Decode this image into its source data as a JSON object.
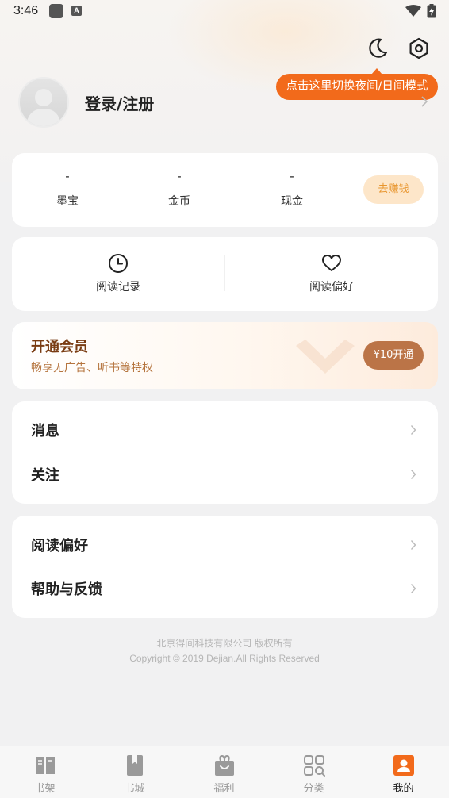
{
  "status_bar": {
    "time": "3:46",
    "notif_icon_letter": "A"
  },
  "header": {
    "tooltip": "点击这里切换夜间/日间模式",
    "login_label": "登录/注册"
  },
  "assets": [
    {
      "value": "-",
      "label": "墨宝"
    },
    {
      "value": "-",
      "label": "金币"
    },
    {
      "value": "-",
      "label": "现金"
    }
  ],
  "earn_button": "去赚钱",
  "reading": [
    {
      "label": "阅读记录",
      "icon": "clock-icon"
    },
    {
      "label": "阅读偏好",
      "icon": "heart-icon"
    }
  ],
  "vip": {
    "title": "开通会员",
    "subtitle": "畅享无广告、听书等特权",
    "button": "¥10开通"
  },
  "menu1": [
    {
      "label": "消息"
    },
    {
      "label": "关注"
    }
  ],
  "menu2": [
    {
      "label": "阅读偏好"
    },
    {
      "label": "帮助与反馈"
    }
  ],
  "footer": {
    "line1": "北京得间科技有限公司  版权所有",
    "line2": "Copyright © 2019 Dejian.All Rights Reserved"
  },
  "tabs": [
    {
      "label": "书架",
      "icon": "bookshelf-icon"
    },
    {
      "label": "书城",
      "icon": "bookmark-icon"
    },
    {
      "label": "福利",
      "icon": "gift-icon"
    },
    {
      "label": "分类",
      "icon": "category-icon"
    },
    {
      "label": "我的",
      "icon": "profile-icon",
      "active": true
    }
  ],
  "colors": {
    "accent": "#f26a1b",
    "vip_button": "#bb7447",
    "earn_bg": "#fde6c9",
    "earn_text": "#e8952d",
    "tab_active": "#f26a1b"
  }
}
